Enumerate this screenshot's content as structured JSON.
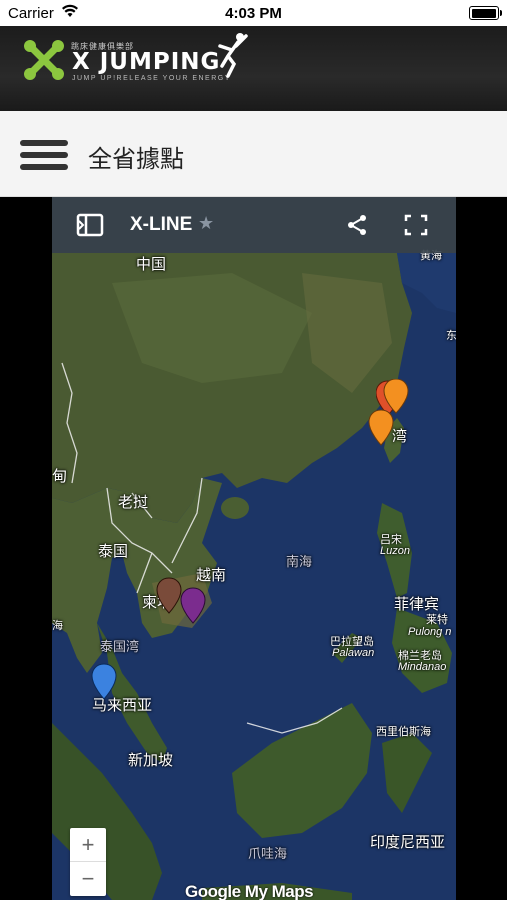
{
  "status": {
    "carrier": "Carrier",
    "time": "4:03 PM",
    "battery_level": 1.0
  },
  "brand": {
    "cn_name": "跳床健康俱樂部",
    "name": "X JUMPING",
    "tagline": "JUMP UP!RELEASE YOUR ENERGY",
    "accent_color": "#8cc63f"
  },
  "page": {
    "title": "全省據點"
  },
  "map": {
    "title": "X-LINE",
    "star": "★",
    "zoom_in": "+",
    "zoom_out": "−",
    "logo": "Google My Maps",
    "labels": {
      "china": "中国",
      "yellow_sea": "黄海",
      "east_sea": "东",
      "taiwan": "湾",
      "myanmar": "甸",
      "laos": "老挝",
      "thailand": "泰国",
      "vietnam": "越南",
      "cambodia": "柬埔",
      "south_china_sea": "南海",
      "luzon_cn": "吕宋",
      "luzon": "Luzon",
      "philippines": "菲律宾",
      "pulong_cn": "莱特",
      "pulong": "Pulong n",
      "palawan_cn": "巴拉望岛",
      "palawan": "Palawan",
      "mindanao_cn": "棉兰老岛",
      "mindanao": "Mindanao",
      "gulf_of_thailand": "泰国湾",
      "sea_left": "海",
      "malaysia": "马来西亚",
      "singapore": "新加坡",
      "celebes": "西里伯斯海",
      "indonesia": "印度尼西亚",
      "java_sea": "爪哇海"
    },
    "markers": [
      {
        "name": "taiwan-north-1",
        "color": "#e0502a"
      },
      {
        "name": "taiwan-north-2",
        "color": "#f39020"
      },
      {
        "name": "taiwan-mid",
        "color": "#f39020"
      },
      {
        "name": "cambodia-1",
        "color": "#7a4b3a"
      },
      {
        "name": "cambodia-2",
        "color": "#7b2c8e"
      },
      {
        "name": "malaysia",
        "color": "#3b82e0"
      }
    ]
  }
}
